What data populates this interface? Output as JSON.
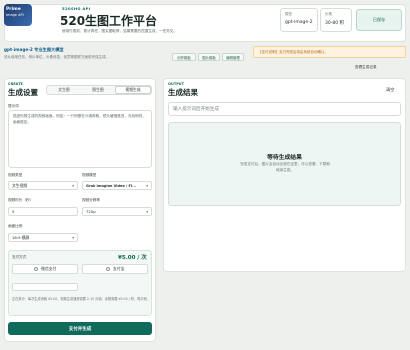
{
  "header": {
    "logo": {
      "line1": "Prime",
      "line2": "Image API"
    },
    "badge": "520SHG API",
    "title": "520生图工作平台",
    "subtitle": "使用付费前，费计算任、图实图取得，结果需要的范围生成，一任务文。",
    "model": {
      "label": "模型",
      "value": "gpt-image-2"
    },
    "pricing": {
      "label": "价格",
      "value": "30-80 积"
    },
    "saved_label": "已保存"
  },
  "info": {
    "heading": "gpt-image-2 专业生图大模型",
    "desc": "请从使用任务，例片单位，头像信息，创意等图样方面前完成生成。",
    "tags": [
      "创作模板",
      "图片模板",
      "编辑管理"
    ]
  },
  "notice": "【支付说明】支付完成后将由系统自动确认。",
  "records_label": "查看生成记录",
  "left": {
    "create_label": "CREATE",
    "title": "生成设置",
    "tabs": [
      "文生图",
      "图生图",
      "视频生成"
    ],
    "active_tab": 2,
    "prompt_label": "提示词",
    "prompt_text": "描述你想生成的视频画面，例如：一只柯基在沙滩奔跑，镜头缓慢推进，光线明亮，画面稳定。",
    "fields": {
      "video_type": {
        "label": "视频类型",
        "value": "文生视频"
      },
      "video_model": {
        "label": "视频模型",
        "value": "Grok Imagine Video / Fl..."
      },
      "duration": {
        "label": "视频时长（秒）",
        "value": "5"
      },
      "resolution": {
        "label": "视频分辨率",
        "value": "720p"
      },
      "ratio": {
        "label": "画面比例",
        "value": "16:9 横屏"
      }
    },
    "payment": {
      "label": "支付方式",
      "price": "¥5.00 / 次",
      "wechat": "微信支付",
      "alipay": "支付宝",
      "note": "正在执行：每次生成消耗 ¥5.00，视频生成通常需要 2-10 分钟。余额需要 ¥5.00 / 积，再次积。"
    },
    "submit_label": "支付并生成"
  },
  "right": {
    "output_label": "OUTPUT",
    "title": "生成结果",
    "clear_label": "清空",
    "input_placeholder": "输入提示词后开始生成",
    "wait_title": "等待生成结果",
    "wait_desc": "完成支付后，图片会自动出现在这里，可以查看、下载和继续生成。"
  }
}
